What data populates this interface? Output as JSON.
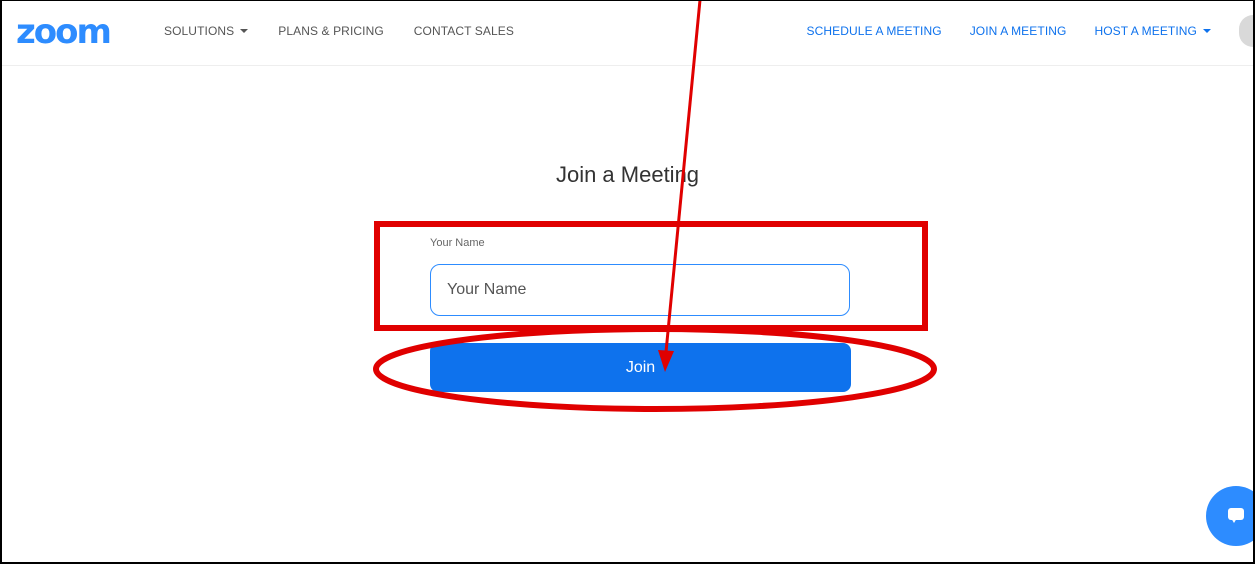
{
  "header": {
    "logo": "zoom",
    "nav_left": [
      {
        "label": "SOLUTIONS",
        "dropdown": true
      },
      {
        "label": "PLANS & PRICING",
        "dropdown": false
      },
      {
        "label": "CONTACT SALES",
        "dropdown": false
      }
    ],
    "nav_right": [
      {
        "label": "SCHEDULE A MEETING",
        "dropdown": false
      },
      {
        "label": "JOIN A MEETING",
        "dropdown": false
      },
      {
        "label": "HOST A MEETING",
        "dropdown": true
      }
    ]
  },
  "main": {
    "title": "Join a Meeting",
    "name_field": {
      "label": "Your Name",
      "placeholder": "Your Name",
      "value": ""
    },
    "join_label": "Join"
  },
  "colors": {
    "brand": "#2d8cff",
    "button": "#0e72ed",
    "annotation": "#e00000"
  },
  "icons": {
    "chat": "chat-bubble-icon"
  }
}
